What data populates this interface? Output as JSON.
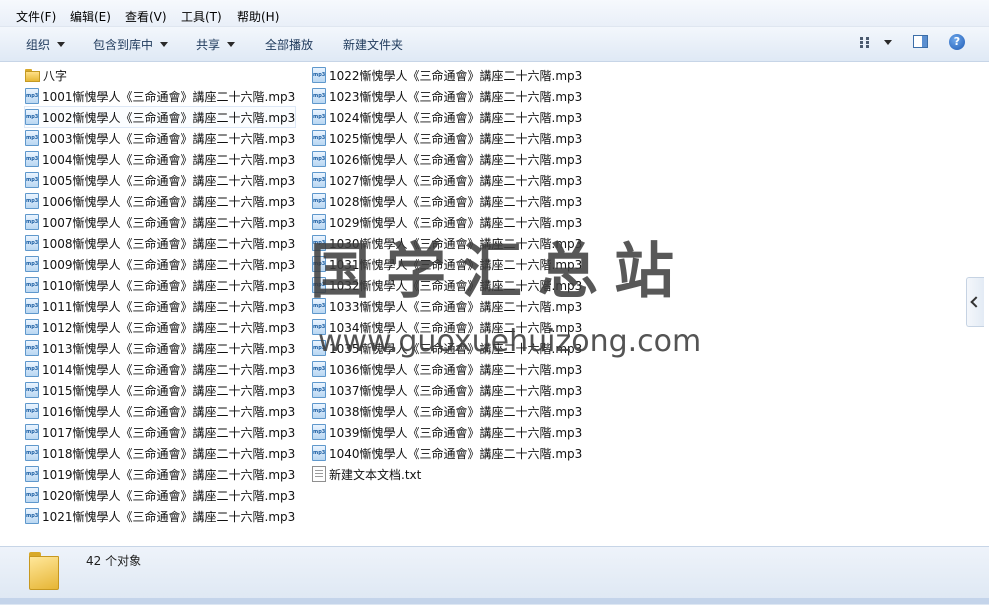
{
  "menubar": {
    "items": [
      "文件(F)",
      "编辑(E)",
      "查看(V)",
      "工具(T)",
      "帮助(H)"
    ]
  },
  "toolbar": {
    "organize": "组织",
    "include": "包含到库中",
    "share": "共享",
    "play_all": "全部播放",
    "new_folder": "新建文件夹"
  },
  "files": {
    "folder": "八字",
    "col1": [
      "1001慚愧學人《三命通會》講座二十六階.mp3",
      "1002慚愧學人《三命通會》講座二十六階.mp3",
      "1003慚愧學人《三命通會》講座二十六階.mp3",
      "1004慚愧學人《三命通會》講座二十六階.mp3",
      "1005慚愧學人《三命通會》講座二十六階.mp3",
      "1006慚愧學人《三命通會》講座二十六階.mp3",
      "1007慚愧學人《三命通會》講座二十六階.mp3",
      "1008慚愧學人《三命通會》講座二十六階.mp3",
      "1009慚愧學人《三命通會》講座二十六階.mp3",
      "1010慚愧學人《三命通會》講座二十六階.mp3",
      "1011慚愧學人《三命通會》講座二十六階.mp3",
      "1012慚愧學人《三命通會》講座二十六階.mp3",
      "1013慚愧學人《三命通會》講座二十六階.mp3",
      "1014慚愧學人《三命通會》講座二十六階.mp3",
      "1015慚愧學人《三命通會》講座二十六階.mp3",
      "1016慚愧學人《三命通會》講座二十六階.mp3",
      "1017慚愧學人《三命通會》講座二十六階.mp3",
      "1018慚愧學人《三命通會》講座二十六階.mp3",
      "1019慚愧學人《三命通會》講座二十六階.mp3",
      "1020慚愧學人《三命通會》講座二十六階.mp3",
      "1021慚愧學人《三命通會》講座二十六階.mp3"
    ],
    "col2": [
      "1022慚愧學人《三命通會》講座二十六階.mp3",
      "1023慚愧學人《三命通會》講座二十六階.mp3",
      "1024慚愧學人《三命通會》講座二十六階.mp3",
      "1025慚愧學人《三命通會》講座二十六階.mp3",
      "1026慚愧學人《三命通會》講座二十六階.mp3",
      "1027慚愧學人《三命通會》講座二十六階.mp3",
      "1028慚愧學人《三命通會》講座二十六階.mp3",
      "1029慚愧學人《三命通會》講座二十六階.mp3",
      "1030慚愧學人《三命通會》講座二十六階.mp3",
      "1031慚愧學人《三命通會》講座二十六階.mp3",
      "1032慚愧學人《三命通會》講座二十六階.mp3",
      "1033慚愧學人《三命通會》講座二十六階.mp3",
      "1034慚愧學人《三命通會》講座二十六階.mp3",
      "1035慚愧學人《三命通會》講座二十六階.mp3",
      "1036慚愧學人《三命通會》講座二十六階.mp3",
      "1037慚愧學人《三命通會》講座二十六階.mp3",
      "1038慚愧學人《三命通會》講座二十六階.mp3",
      "1039慚愧學人《三命通會》講座二十六階.mp3",
      "1040慚愧學人《三命通會》講座二十六階.mp3"
    ],
    "txt": "新建文本文档.txt"
  },
  "watermark": {
    "cn": "国学汇总站",
    "url": "www.guoxuehuizong.com"
  },
  "status": {
    "count": "42 个对象"
  },
  "icons": {
    "folder": "folder-icon",
    "mp3": "mp3-file-icon",
    "txt": "text-file-icon",
    "help": "help-icon",
    "view": "view-options-icon",
    "pane": "preview-pane-icon"
  }
}
